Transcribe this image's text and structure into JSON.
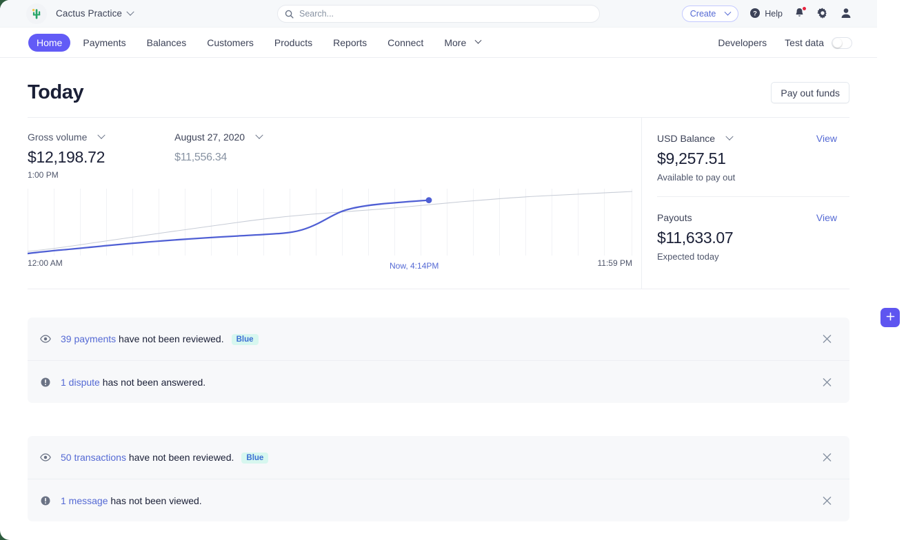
{
  "brand": {
    "name": "Cactus Practice",
    "logo_icon": "cactus-icon"
  },
  "search": {
    "placeholder": "Search...",
    "value": "",
    "icon": "search-icon"
  },
  "topbar": {
    "create_label": "Create",
    "help_label": "Help",
    "notifications_icon": "bell-icon",
    "settings_icon": "gear-icon",
    "account_icon": "user-icon"
  },
  "nav": {
    "tabs": [
      {
        "label": "Home",
        "active": true
      },
      {
        "label": "Payments",
        "active": false
      },
      {
        "label": "Balances",
        "active": false
      },
      {
        "label": "Customers",
        "active": false
      },
      {
        "label": "Products",
        "active": false
      },
      {
        "label": "Reports",
        "active": false
      },
      {
        "label": "Connect",
        "active": false
      },
      {
        "label": "More",
        "active": false
      }
    ],
    "developers_label": "Developers",
    "test_data_label": "Test data",
    "test_data_on": false
  },
  "page": {
    "title": "Today",
    "payout_button": "Pay out funds"
  },
  "overview": {
    "metric": {
      "label": "Gross volume",
      "value": "$12,198.72",
      "time": "1:00 PM"
    },
    "compare": {
      "label": "August 27, 2020",
      "value": "$11,556.34"
    },
    "axis": {
      "start": "12:00 AM",
      "now": "Now, 4:14PM",
      "end": "11:59 PM"
    }
  },
  "balances": [
    {
      "title": "USD Balance",
      "has_caret": true,
      "link": "View",
      "value": "$9,257.51",
      "subtitle": "Available to pay out"
    },
    {
      "title": "Payouts",
      "has_caret": false,
      "link": "View",
      "value": "$11,633.07",
      "subtitle": "Expected today"
    }
  ],
  "notice_groups": [
    {
      "items": [
        {
          "icon": "eye-icon",
          "link": "39 payments",
          "text": " have not been reviewed.",
          "pill": "Blue",
          "close_icon": "close-icon"
        },
        {
          "icon": "alert-icon",
          "link": "1 dispute",
          "text": " has not been answered.",
          "pill": "",
          "close_icon": "close-icon"
        }
      ]
    },
    {
      "items": [
        {
          "icon": "eye-icon",
          "link": "50 transactions",
          "text": " have not been reviewed.",
          "pill": "Blue",
          "close_icon": "close-icon"
        },
        {
          "icon": "alert-icon",
          "link": "1 message",
          "text": " has not been viewed.",
          "pill": "",
          "close_icon": "close-icon"
        }
      ]
    }
  ],
  "fab": {
    "icon": "plus-icon",
    "color": "#5e55f0"
  },
  "colors": {
    "accent": "#5469d4",
    "nav_active": "#625bf6",
    "chart_line": "#4f5fd4",
    "chart_compare": "#c7ccd6",
    "badge_red": "#e8243f",
    "pill_bg": "#d7f7ef",
    "pill_text": "#3c6fd4"
  },
  "chart_data": {
    "type": "line",
    "title": "Gross volume",
    "xlabel": "",
    "ylabel": "",
    "xlim": [
      "12:00 AM",
      "11:59 PM"
    ],
    "grid": "vertical",
    "legend": "none",
    "annotations": [
      {
        "label": "Now, 4:14PM",
        "x_frac": 0.64
      }
    ],
    "series": [
      {
        "name": "Today",
        "color": "#4f5fd4",
        "end_marker": true,
        "x_frac": [
          0.0,
          0.05,
          0.1,
          0.15,
          0.2,
          0.25,
          0.3,
          0.35,
          0.4,
          0.45,
          0.5,
          0.55,
          0.6,
          0.64
        ],
        "y_value": [
          0,
          380,
          900,
          1500,
          2100,
          2700,
          3250,
          3800,
          4500,
          5600,
          7200,
          9000,
          10600,
          12198.72
        ]
      },
      {
        "name": "August 27, 2020",
        "color": "#c7ccd6",
        "end_marker": false,
        "x_frac": [
          0.0,
          0.1,
          0.2,
          0.3,
          0.4,
          0.5,
          0.6,
          0.64,
          0.7,
          0.8,
          0.9,
          1.0
        ],
        "y_value": [
          0,
          850,
          2050,
          3150,
          4350,
          5700,
          7000,
          7550,
          8600,
          9900,
          10950,
          11556.34
        ]
      }
    ]
  }
}
